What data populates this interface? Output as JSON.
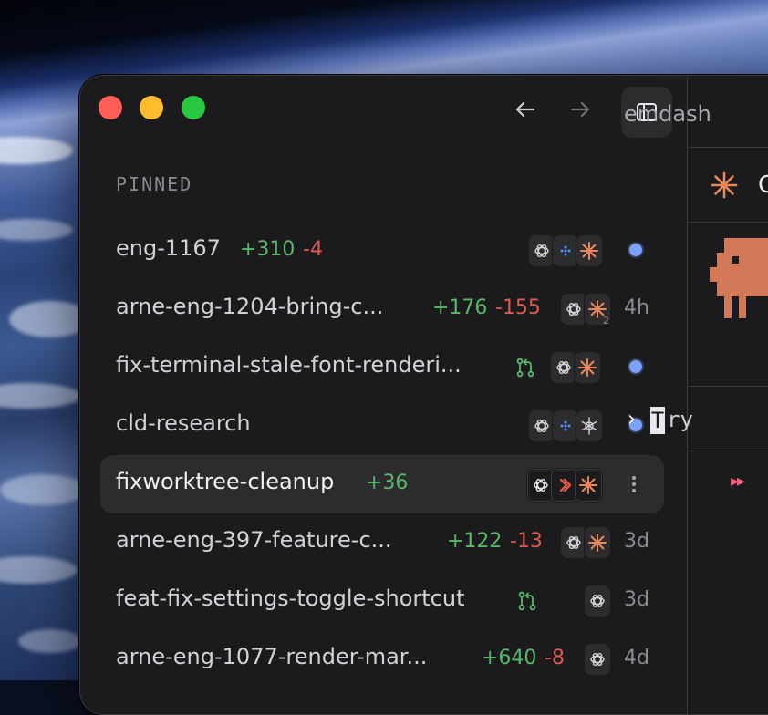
{
  "window": {
    "right_pane_title": "emdash",
    "right_pane_tab_initial": "C",
    "terminal": {
      "prompt_symbol": "›",
      "cursor_char": "T",
      "input_text": "ry",
      "status_glyph": "▸▸"
    }
  },
  "sidebar": {
    "section_title": "PINNED",
    "rows": [
      {
        "label": "eng-1167",
        "additions": "+310",
        "deletions": "-4",
        "agents": [
          "openai",
          "gemini",
          "claude"
        ],
        "status": "dot",
        "time": ""
      },
      {
        "label": "arne-eng-1204-bring-c...",
        "additions": "+176",
        "deletions": "-155",
        "agents": [
          "openai",
          "claude"
        ],
        "agent_count": "2",
        "status": "",
        "time": "4h"
      },
      {
        "label": "fix-terminal-stale-font-renderi...",
        "additions": "",
        "deletions": "",
        "pr": true,
        "agents": [
          "openai",
          "claude"
        ],
        "status": "dot",
        "time": ""
      },
      {
        "label": "cld-research",
        "additions": "",
        "deletions": "",
        "agents": [
          "openai",
          "gemini",
          "perplexity"
        ],
        "status": "dot",
        "time": ""
      },
      {
        "label": "fixworktree-cleanup",
        "additions": "+36",
        "deletions": "",
        "agents": [
          "openai",
          "factory",
          "claude"
        ],
        "status": "more",
        "time": "",
        "selected": true
      },
      {
        "label": "arne-eng-397-feature-c...",
        "additions": "+122",
        "deletions": "-13",
        "agents": [
          "openai",
          "claude"
        ],
        "status": "",
        "time": "3d"
      },
      {
        "label": "feat-fix-settings-toggle-shortcut",
        "additions": "",
        "deletions": "",
        "pr": true,
        "agents": [
          "openai"
        ],
        "status": "",
        "time": "3d"
      },
      {
        "label": "arne-eng-1077-render-mar...",
        "additions": "+640",
        "deletions": "-8",
        "agents": [
          "openai"
        ],
        "status": "",
        "time": "4d"
      }
    ]
  },
  "colors": {
    "accent_blue": "#7aa2ff",
    "addition_green": "#57b86a",
    "deletion_red": "#e1584f",
    "claude_orange": "#e8865c",
    "close": "#ff5f57",
    "minimize": "#febc2e",
    "zoom": "#28c840"
  },
  "icons": {
    "back": "arrow-left-icon",
    "forward": "arrow-right-icon",
    "sidebar_toggle": "sidebar-toggle-icon",
    "pull_request": "git-pull-request-icon"
  }
}
